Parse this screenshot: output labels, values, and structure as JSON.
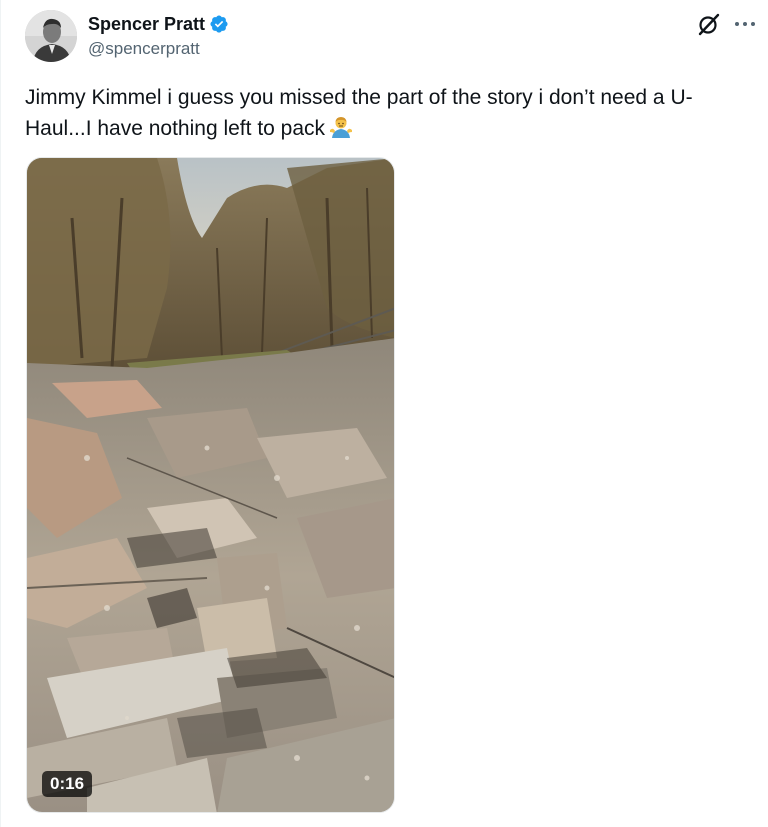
{
  "author": {
    "display_name": "Spencer Pratt",
    "handle": "@spencerpratt",
    "verified_color": "#1d9bf0",
    "avatar_icon": "avatar"
  },
  "header_icons": [
    "grok-icon",
    "more-icon"
  ],
  "tweet": {
    "text": "Jimmy Kimmel i guess you missed the part of the story i don’t need a U-Haul...I have nothing left to pack",
    "emoji": "man-shrugging-emoji"
  },
  "media": {
    "type": "video",
    "duration": "0:16"
  }
}
